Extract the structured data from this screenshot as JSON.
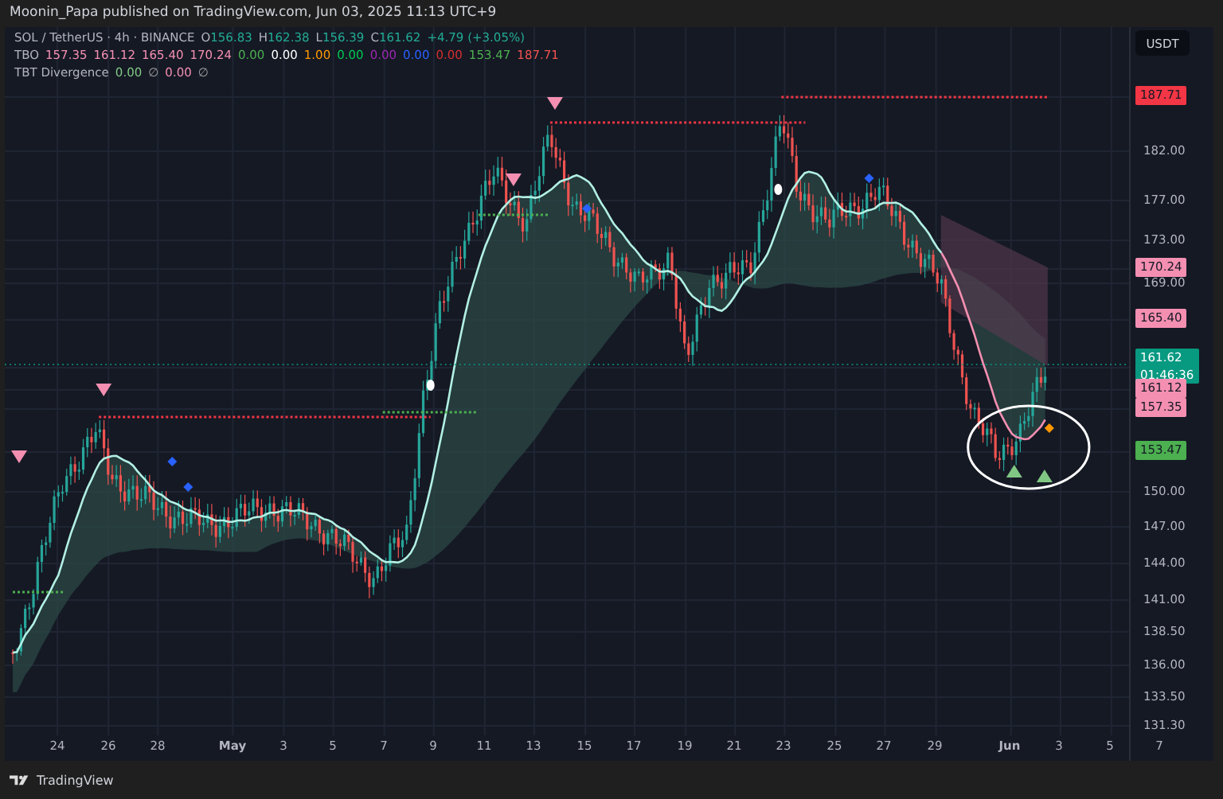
{
  "header": {
    "text": "Moonin_Papa published on TradingView.com, Jun 03, 2025 11:13 UTC+9"
  },
  "legend": {
    "symbol": "SOL / TetherUS · 4h · BINANCE",
    "ohlc": [
      {
        "label": "O",
        "value": "156.83"
      },
      {
        "label": "H",
        "value": "162.38"
      },
      {
        "label": "L",
        "value": "156.39"
      },
      {
        "label": "C",
        "value": "161.62"
      }
    ],
    "change": "+4.79 (+3.05%)",
    "indicators": [
      {
        "name": "TBO",
        "values": [
          {
            "text": "157.35",
            "color": "#f48fb1"
          },
          {
            "text": "161.12",
            "color": "#f48fb1"
          },
          {
            "text": "165.40",
            "color": "#f48fb1"
          },
          {
            "text": "170.24",
            "color": "#f48fb1"
          },
          {
            "text": "0.00",
            "color": "#4caf50"
          },
          {
            "text": "0.00",
            "color": "#ffffff"
          },
          {
            "text": "1.00",
            "color": "#ff9800"
          },
          {
            "text": "0.00",
            "color": "#00c853"
          },
          {
            "text": "0.00",
            "color": "#9c27b0"
          },
          {
            "text": "0.00",
            "color": "#2962ff"
          },
          {
            "text": "0.00",
            "color": "#d32f2f"
          },
          {
            "text": "153.47",
            "color": "#4caf50"
          },
          {
            "text": "187.71",
            "color": "#ef5350"
          }
        ]
      },
      {
        "name": "TBT Divergence",
        "values": [
          {
            "text": "0.00",
            "color": "#81c784"
          },
          {
            "text": "∅",
            "color": "#9e9e9e"
          },
          {
            "text": "0.00",
            "color": "#f48fb1"
          },
          {
            "text": "∅",
            "color": "#9e9e9e"
          }
        ]
      }
    ]
  },
  "currency_button": "USDT",
  "price_axis": [
    {
      "kind": "tag",
      "text": "187.71",
      "color": "#f23645"
    },
    {
      "kind": "tick",
      "text": "182.00"
    },
    {
      "kind": "tick",
      "text": "177.00"
    },
    {
      "kind": "tick",
      "text": "173.00"
    },
    {
      "kind": "tag",
      "text": "170.24",
      "color": "#f48fb1"
    },
    {
      "kind": "tick",
      "text": "169.00"
    },
    {
      "kind": "tag",
      "text": "165.40",
      "color": "#f48fb1"
    },
    {
      "kind": "last",
      "text": "161.62",
      "countdown": "01:46:36",
      "color": "#089981"
    },
    {
      "kind": "tag",
      "text": "161.12",
      "color": "#f48fb1"
    },
    {
      "kind": "tag",
      "text": "157.35",
      "color": "#f48fb1"
    },
    {
      "kind": "tag",
      "text": "153.47",
      "color": "#4caf50"
    },
    {
      "kind": "tick",
      "text": "150.00"
    },
    {
      "kind": "tick",
      "text": "147.00"
    },
    {
      "kind": "tick",
      "text": "144.00"
    },
    {
      "kind": "tick",
      "text": "141.00"
    },
    {
      "kind": "tick",
      "text": "138.50"
    },
    {
      "kind": "tick",
      "text": "136.00"
    },
    {
      "kind": "tick",
      "text": "133.50"
    },
    {
      "kind": "tick",
      "text": "131.30"
    }
  ],
  "time_axis": [
    "24",
    "26",
    "28",
    "May",
    "3",
    "5",
    "7",
    "9",
    "11",
    "13",
    "15",
    "17",
    "19",
    "21",
    "23",
    "25",
    "27",
    "29",
    "Jun",
    "3",
    "5",
    "7"
  ],
  "footer": {
    "brand": "TradingView"
  }
}
